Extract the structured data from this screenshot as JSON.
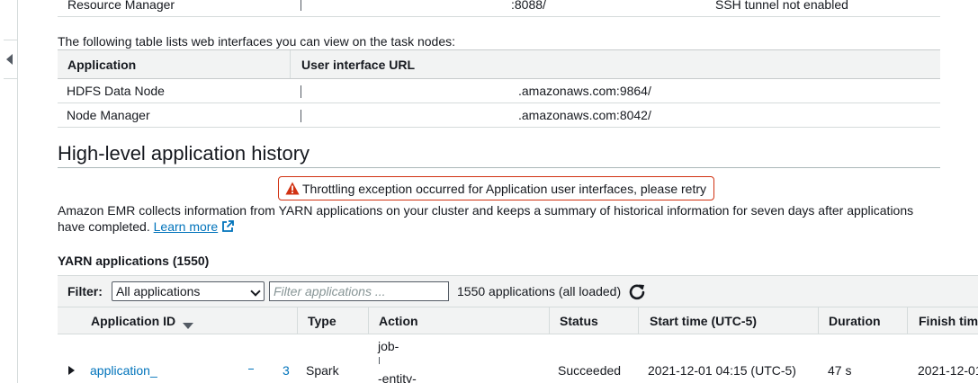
{
  "nav": {
    "collapse_icon": "caret-left-icon"
  },
  "master_table": {
    "partial_row": {
      "application": "Resource Manager",
      "url_tail": ":8088/",
      "status": "SSH tunnel not enabled"
    }
  },
  "task_nodes": {
    "intro": "The following table lists web interfaces you can view on the task nodes:",
    "columns": [
      "Application",
      "User interface URL"
    ],
    "rows": [
      {
        "application": "HDFS Data Node",
        "url_tail": ".amazonaws.com:9864/"
      },
      {
        "application": "Node Manager",
        "url_tail": ".amazonaws.com:8042/"
      }
    ]
  },
  "history": {
    "title": "High-level application history",
    "alert": {
      "icon": "warning-triangle-icon",
      "message": "Throttling exception occurred for Application user interfaces, please retry",
      "color": "#d13212"
    },
    "description": "Amazon EMR collects information from YARN applications on your cluster and keeps a summary of historical information for seven days after applications have completed.",
    "learn_more": "Learn more",
    "link_color": "#0073bb"
  },
  "yarn": {
    "title": "YARN applications (1550)",
    "filter": {
      "label": "Filter:",
      "selected": "All applications",
      "placeholder": "Filter applications ...",
      "loaded_text": "1550 applications (all loaded)",
      "refresh_icon": "refresh-icon"
    },
    "columns": [
      "Application ID",
      "Type",
      "Action",
      "Status",
      "Start time (UTC-5)",
      "Duration",
      "Finish tim"
    ],
    "rows": [
      {
        "application_id": "application_",
        "application_id_tail": "3",
        "type": "Spark",
        "action_line1": "job-",
        "action_line2": "-entity-",
        "status": "Succeeded",
        "start_time": "2021-12-01 04:15 (UTC-5)",
        "duration": "47 s",
        "finish_time": "2021-12-01"
      }
    ]
  }
}
